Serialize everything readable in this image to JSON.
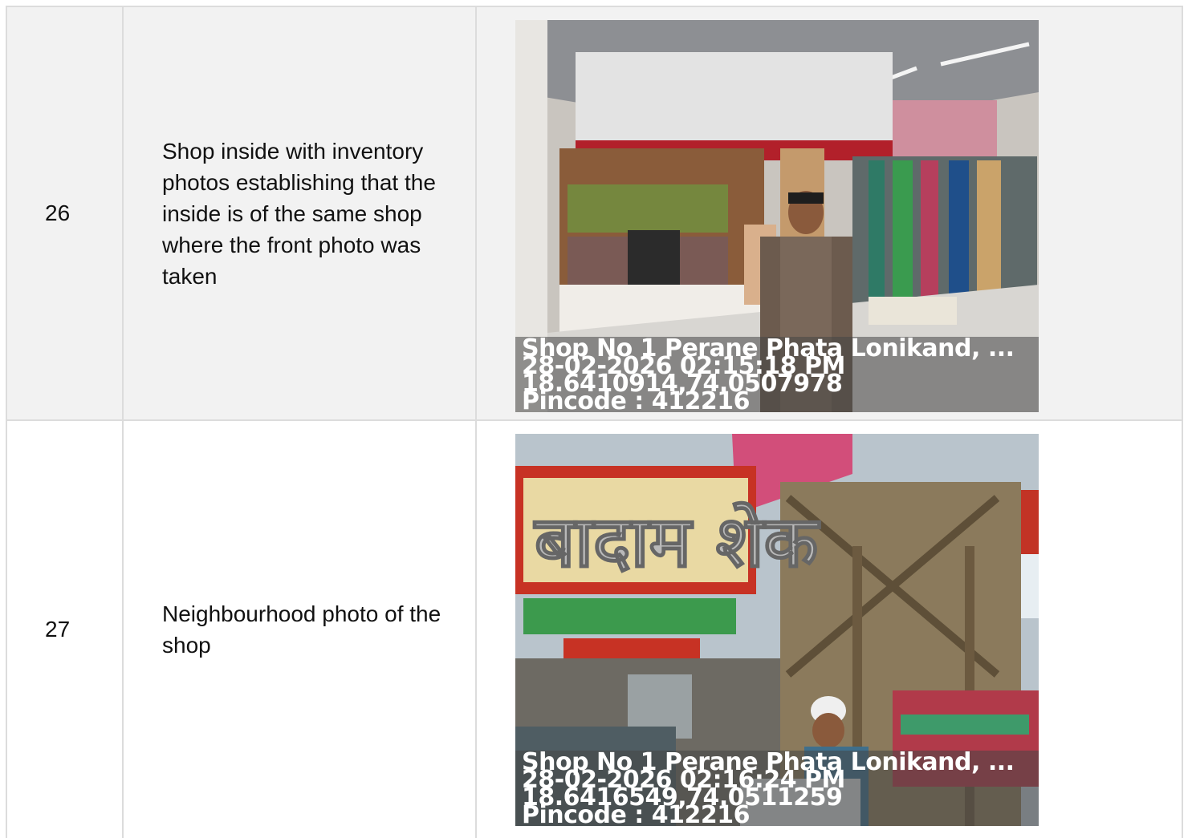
{
  "rows": [
    {
      "number": "26",
      "description": "Shop inside with inventory photos establishing that the inside is of the same shop where the front photo was taken",
      "photo": {
        "address": "Shop No 1 Perane Phata Lonikand, ...",
        "datetime": "28-02-2026 02:15:18 PM",
        "coordinates": "18.6410914,74.0507978",
        "pincode": "Pincode : 412216"
      }
    },
    {
      "number": "27",
      "description": "Neighbourhood photo of the shop",
      "photo": {
        "address": "Shop No 1 Perane Phata Lonikand, ...",
        "datetime": "28-02-2026 02:16:24 PM",
        "coordinates": "18.6416549,74.0511259",
        "pincode": "Pincode : 412216",
        "sign_text": "बादाम शेक"
      }
    }
  ]
}
